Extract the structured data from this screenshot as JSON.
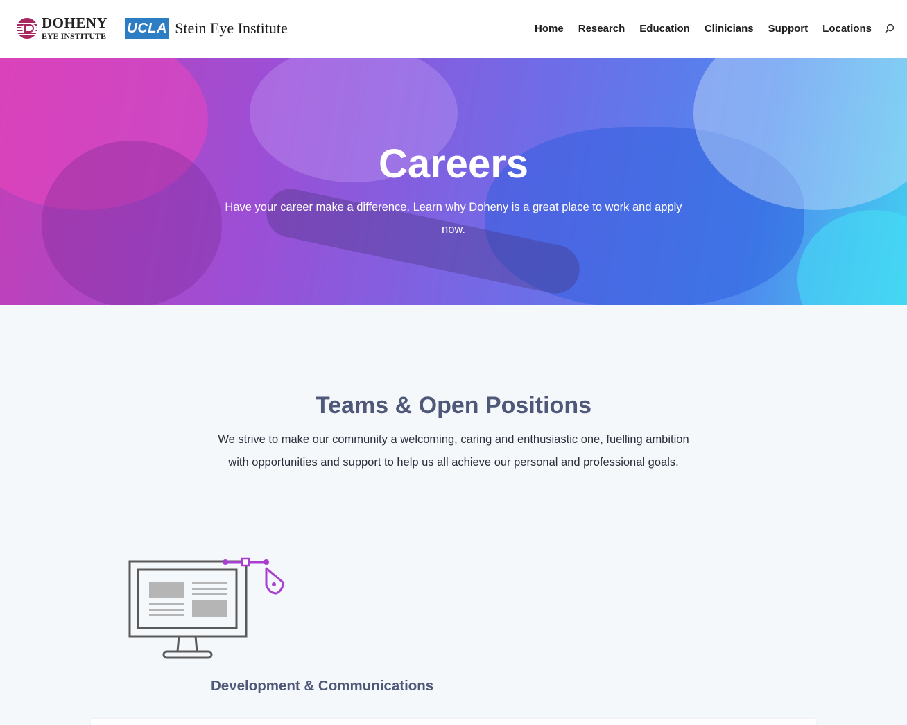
{
  "header": {
    "logo": {
      "doheny_name": "DOHENY",
      "doheny_sub": "EYE INSTITUTE",
      "ucla": "UCLA",
      "stein": "Stein Eye Institute"
    },
    "nav": [
      {
        "label": "Home"
      },
      {
        "label": "Research"
      },
      {
        "label": "Education"
      },
      {
        "label": "Clinicians"
      },
      {
        "label": "Support"
      },
      {
        "label": "Locations"
      }
    ],
    "search_icon": "search-icon"
  },
  "hero": {
    "title": "Careers",
    "subtitle": "Have your career make a difference. Learn why Doheny is a great place to work and apply now."
  },
  "section": {
    "title": "Teams & Open Positions",
    "text": "We strive to make our community a welcoming, caring and enthusiastic one, fuelling ambition with opportunities and support to help us all achieve our personal and professional goals."
  },
  "team": {
    "title": "Development & Communications",
    "icon": "monitor-design-icon"
  },
  "colors": {
    "heading": "#4f5879",
    "accent": "#a83fd0",
    "ucla_blue": "#2d7dc4",
    "page_bg": "#f5f8fb"
  }
}
